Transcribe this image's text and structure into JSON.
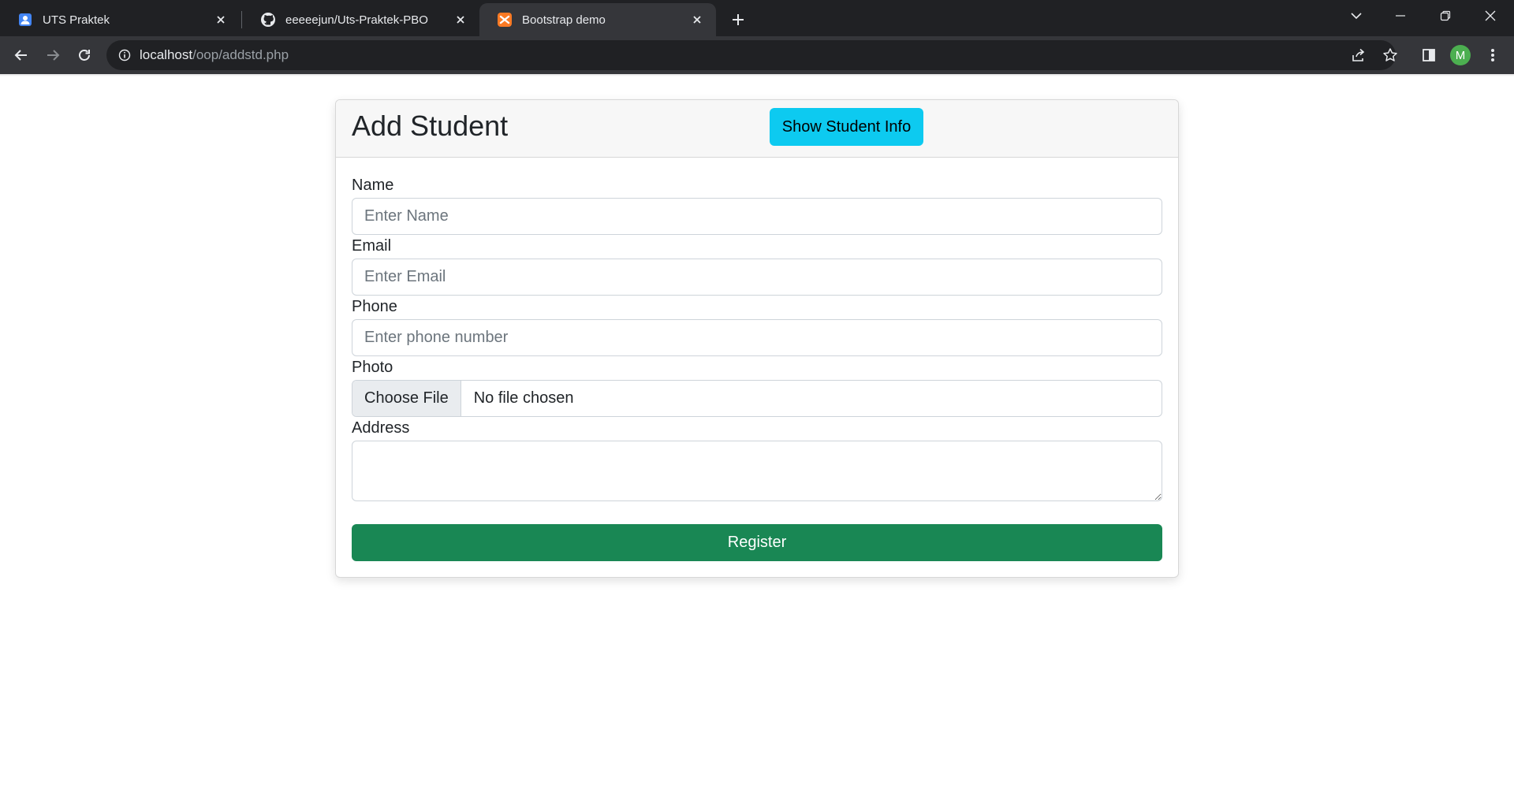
{
  "browser": {
    "tabs": [
      {
        "title": "UTS Praktek",
        "icon": "contact-icon",
        "active": false
      },
      {
        "title": "eeeeejun/Uts-Praktek-PBO",
        "icon": "github-icon",
        "active": false
      },
      {
        "title": "Bootstrap demo",
        "icon": "xampp-icon",
        "active": true
      }
    ],
    "url": {
      "host": "localhost",
      "path": "/oop/addstd.php"
    },
    "profile_initial": "M",
    "colors": {
      "tabbar": "#202124",
      "toolbar": "#35363a",
      "avatar": "#4caf50"
    }
  },
  "form": {
    "title": "Add Student",
    "show_info_label": "Show Student Info",
    "fields": {
      "name": {
        "label": "Name",
        "placeholder": "Enter Name"
      },
      "email": {
        "label": "Email",
        "placeholder": "Enter Email"
      },
      "phone": {
        "label": "Phone",
        "placeholder": "Enter phone number"
      },
      "photo": {
        "label": "Photo",
        "button": "Choose File",
        "status": "No file chosen"
      },
      "address": {
        "label": "Address"
      }
    },
    "submit_label": "Register",
    "colors": {
      "info_button": "#0dcaf0",
      "submit_button": "#198754"
    }
  }
}
